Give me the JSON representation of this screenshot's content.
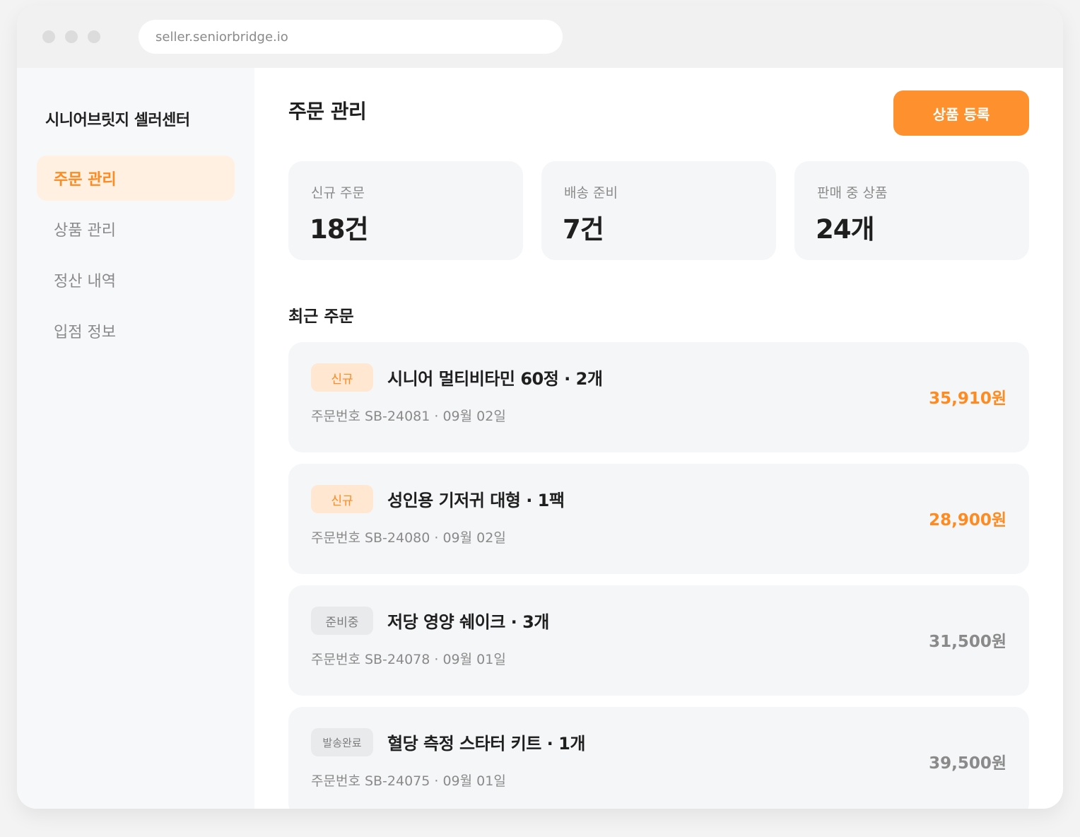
{
  "browser": {
    "url": "seller.seniorbridge.io"
  },
  "sidebar": {
    "brand": "시니어브릿지 셀러센터",
    "items": [
      {
        "label": "주문 관리",
        "active": true
      },
      {
        "label": "상품 관리",
        "active": false
      },
      {
        "label": "정산 내역",
        "active": false
      },
      {
        "label": "입점 정보",
        "active": false
      }
    ]
  },
  "header": {
    "title": "주문 관리",
    "register_button": "상품 등록"
  },
  "stats": [
    {
      "label": "신규 주문",
      "value": "18건"
    },
    {
      "label": "배송 준비",
      "value": "7건"
    },
    {
      "label": "판매 중 상품",
      "value": "24개"
    }
  ],
  "recent_orders": {
    "title": "최근 주문",
    "orders": [
      {
        "status": "신규",
        "item": "시니어 멀티비타민 60정 · 2개",
        "meta": "주문번호 SB-24081 · 09월 02일",
        "price": "35,910원"
      },
      {
        "status": "신규",
        "item": "성인용 기저귀 대형 · 1팩",
        "meta": "주문번호 SB-24080 · 09월 02일",
        "price": "28,900원"
      },
      {
        "status": "준비중",
        "item": "저당 영양 쉐이크 · 3개",
        "meta": "주문번호 SB-24078 · 09월 01일",
        "price": "31,500원"
      },
      {
        "status": "발송완료",
        "item": "혈당 측정 스타터 키트 · 1개",
        "meta": "주문번호 SB-24075 · 09월 01일",
        "price": "39,500원"
      }
    ]
  },
  "colors": {
    "accent": "#ff8a1f",
    "accent_button": "#ff902e",
    "accent_soft": "#fff0e2",
    "badge_new_bg": "#ffe7d1",
    "badge_neutral_bg": "#e9eaec",
    "card_bg": "#f5f6f8",
    "muted_text": "#8a8a8a"
  }
}
